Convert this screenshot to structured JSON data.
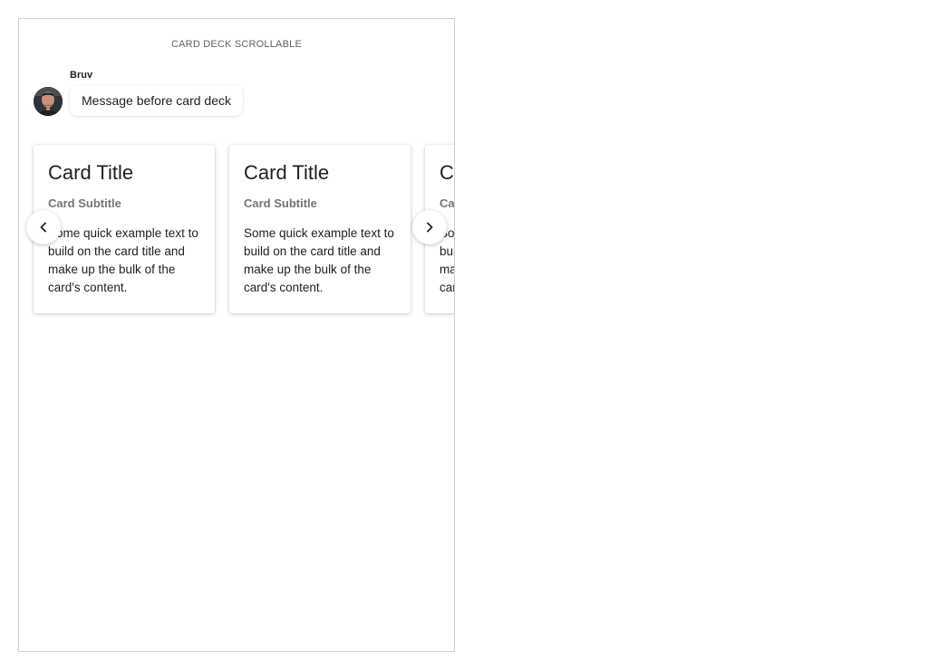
{
  "panel": {
    "title": "CARD DECK SCROLLABLE"
  },
  "message": {
    "sender": "Bruv",
    "text": "Message before card deck",
    "avatar_icon": "user-photo-avatar"
  },
  "deck": {
    "prev_icon": "chevron-left-icon",
    "next_icon": "chevron-right-icon",
    "cards": [
      {
        "title": "Card Title",
        "subtitle": "Card Subtitle",
        "text": "Some quick example text to build on the card title and make up the bulk of the card's content."
      },
      {
        "title": "Card Title",
        "subtitle": "Card Subtitle",
        "text": "Some quick example text to build on the card title and make up the bulk of the card's content."
      },
      {
        "title": "Card Title",
        "subtitle": "Card Subtitle",
        "text": "Some quick example text to build on the card title and make up the bulk of the card's content."
      }
    ]
  },
  "colors": {
    "border": "#d0d0d0",
    "text_primary": "#212121",
    "text_secondary": "#757575",
    "background": "#ffffff"
  }
}
